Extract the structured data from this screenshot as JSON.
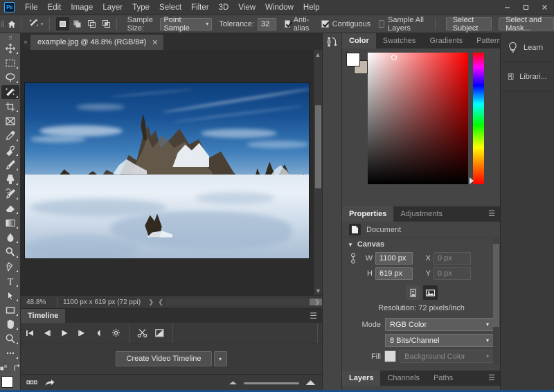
{
  "app": {
    "logo_text": "Ps",
    "menu": [
      "File",
      "Edit",
      "Image",
      "Layer",
      "Type",
      "Select",
      "Filter",
      "3D",
      "View",
      "Window",
      "Help"
    ],
    "window_buttons": [
      "minimize",
      "maximize",
      "close"
    ]
  },
  "options_bar": {
    "home_icon": "home-icon",
    "active_tool": "magic-wand-tool",
    "selection_modes": [
      "new-selection",
      "add-to-selection",
      "subtract-from-selection",
      "intersect-with-selection"
    ],
    "active_selection_mode": 0,
    "sample_size_label": "Sample Size:",
    "sample_size_value": "Point Sample",
    "tolerance_label": "Tolerance:",
    "tolerance_value": "32",
    "anti_alias_label": "Anti-alias",
    "anti_alias_checked": true,
    "contiguous_label": "Contiguous",
    "contiguous_checked": true,
    "sample_all_layers_label": "Sample All Layers",
    "sample_all_layers_checked": false,
    "select_subject_label": "Select Subject",
    "select_and_mask_label": "Select and Mask..."
  },
  "toolbar": {
    "tools": [
      {
        "name": "move-tool",
        "has_flyout": true
      },
      {
        "name": "rectangular-marquee-tool",
        "has_flyout": true
      },
      {
        "name": "lasso-tool",
        "has_flyout": true
      },
      {
        "name": "magic-wand-tool",
        "has_flyout": true,
        "active": true
      },
      {
        "name": "crop-tool",
        "has_flyout": true
      },
      {
        "name": "frame-tool",
        "has_flyout": false
      },
      {
        "name": "eyedropper-tool",
        "has_flyout": true
      },
      {
        "name": "spot-healing-brush-tool",
        "has_flyout": true
      },
      {
        "name": "brush-tool",
        "has_flyout": true
      },
      {
        "name": "clone-stamp-tool",
        "has_flyout": true
      },
      {
        "name": "history-brush-tool",
        "has_flyout": true
      },
      {
        "name": "eraser-tool",
        "has_flyout": true
      },
      {
        "name": "gradient-tool",
        "has_flyout": true
      },
      {
        "name": "blur-tool",
        "has_flyout": true
      },
      {
        "name": "dodge-tool",
        "has_flyout": true
      },
      {
        "name": "pen-tool",
        "has_flyout": true
      },
      {
        "name": "type-tool",
        "has_flyout": true
      },
      {
        "name": "path-selection-tool",
        "has_flyout": true
      },
      {
        "name": "rectangle-tool",
        "has_flyout": true
      },
      {
        "name": "hand-tool",
        "has_flyout": true
      },
      {
        "name": "zoom-tool",
        "has_flyout": true
      },
      {
        "name": "edit-toolbar-tool",
        "has_flyout": false
      }
    ],
    "foreground_color": "#ffffff",
    "background_color": "#b9b2a5"
  },
  "document": {
    "tab_title": "example.jpg @ 48.8% (RGB/8#)",
    "close_icon": "close-icon",
    "image_alt": "snow-covered alpine mountain peak under deep blue sky"
  },
  "status_bar": {
    "zoom": "48.8%",
    "doc_size": "1100 px x 619 px (72 ppi)"
  },
  "timeline": {
    "tabs": [
      {
        "label": "Timeline",
        "active": true
      }
    ],
    "menu_icon": "panel-menu-icon",
    "controls": [
      "go-to-first-frame-icon",
      "go-to-previous-frame-icon",
      "play-icon",
      "go-to-next-frame-icon",
      "audio-icon",
      "settings-gear-icon"
    ],
    "edit_controls": [
      "split-at-playhead-icon",
      "transition-icon"
    ],
    "create_button_label": "Create Video Timeline",
    "create_button_caret": "chevron-down-icon"
  },
  "app_status": {
    "grid_icon": "grid-view-icon",
    "share_icon": "share-icon",
    "zoom_out_icon": "zoom-out-icon",
    "zoom_in_icon": "zoom-in-icon"
  },
  "color_panel": {
    "tabs": [
      {
        "label": "Color",
        "active": true
      },
      {
        "label": "Swatches",
        "active": false
      },
      {
        "label": "Gradients",
        "active": false
      },
      {
        "label": "Patterns",
        "active": false
      }
    ],
    "menu_icon": "panel-menu-icon",
    "foreground_color": "#ffffff",
    "background_color": "#c0b9ab",
    "picker_mode": "hue-cube",
    "hue_position_pct": 95
  },
  "properties_panel": {
    "tabs": [
      {
        "label": "Properties",
        "active": true
      },
      {
        "label": "Adjustments",
        "active": false
      }
    ],
    "menu_icon": "panel-menu-icon",
    "doc_icon": "document-icon",
    "doc_label": "Document",
    "section_title": "Canvas",
    "section_caret": "chevron-down-icon",
    "link_icon": "link-dimensions-icon",
    "width_label": "W",
    "width_value": "1100 px",
    "height_label": "H",
    "height_value": "619 px",
    "x_label": "X",
    "x_placeholder": "0 px",
    "y_label": "Y",
    "y_placeholder": "0 px",
    "orientation_portrait_icon": "orientation-portrait-icon",
    "orientation_landscape_icon": "orientation-landscape-icon",
    "orientation_active": "landscape",
    "resolution_text": "Resolution: 72 pixels/inch",
    "mode_label": "Mode",
    "mode_value": "RGB Color",
    "depth_value": "8 Bits/Channel",
    "fill_label": "Fill",
    "fill_swatch_color": "#d8d8d8",
    "fill_value": "Background Color"
  },
  "layers_panel": {
    "tabs": [
      {
        "label": "Layers",
        "active": true
      },
      {
        "label": "Channels",
        "active": false
      },
      {
        "label": "Paths",
        "active": false
      }
    ],
    "menu_icon": "panel-menu-icon"
  },
  "far_rail": {
    "items": [
      {
        "label": "Learn",
        "icon": "lightbulb-icon"
      },
      {
        "label": "Librari...",
        "icon": "libraries-book-icon"
      }
    ]
  },
  "dock_rail": {
    "items": [
      {
        "icon": "history-states-icon"
      }
    ]
  },
  "colors": {
    "window_chrome": "#3b3b3b",
    "options_bar": "#454545",
    "toolbar": "#535353",
    "canvas_bg": "#2c2c2c",
    "panel_bg": "#454545",
    "accent_blue": "#31a8ff",
    "tab_active": "#4a4a4a"
  }
}
